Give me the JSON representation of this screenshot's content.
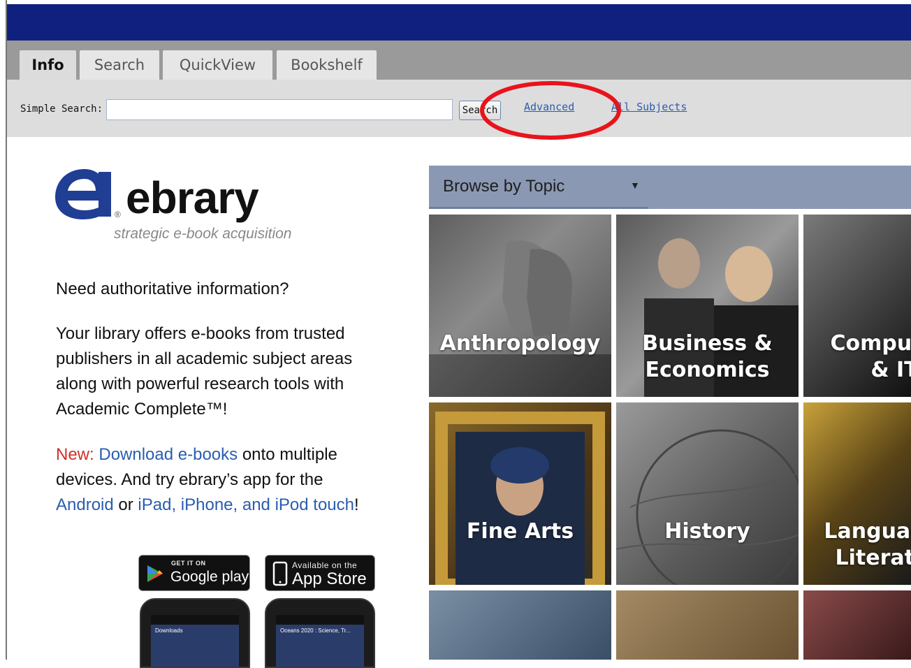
{
  "tabs": [
    {
      "label": "Info",
      "active": true
    },
    {
      "label": "Search",
      "active": false
    },
    {
      "label": "QuickView",
      "active": false
    },
    {
      "label": "Bookshelf",
      "active": false
    }
  ],
  "search": {
    "label": "Simple Search:",
    "value": "",
    "button_label": "Search",
    "advanced_label": "Advanced",
    "subjects_label": "All Subjects"
  },
  "annotation": {
    "color": "#e8141c"
  },
  "logo": {
    "brand": "ebrary",
    "registered": "®",
    "tagline": "strategic e-book acquisition"
  },
  "content": {
    "question": "Need authoritative information?",
    "para1": "Your library offers e-books from trusted publishers in all academic subject areas along with powerful research tools with Academic Complete™!",
    "new_label": "New:",
    "download_link": "Download e-books",
    "download_rest": " onto multiple devices. And try ebrary’s app for the ",
    "android_link": "Android",
    "or_text": " or ",
    "ios_link": "iPad, iPhone, and iPod touch",
    "end": "!"
  },
  "badges": {
    "google_small": "GET IT ON",
    "google_big": "Google play",
    "apple_small": "Available on the",
    "apple_big": "App Store"
  },
  "phones": {
    "android_screen": "Downloads",
    "iphone_screen": "Oceans 2020 : Science, Tr..."
  },
  "browse": {
    "header": "Browse by Topic",
    "tiles": [
      {
        "label": "Anthropology"
      },
      {
        "label": "Business &\nEconomics"
      },
      {
        "label": "Computers\n& IT"
      },
      {
        "label": "Fine Arts"
      },
      {
        "label": "History"
      },
      {
        "label": "Language &\nLiterature"
      },
      {
        "label": ""
      },
      {
        "label": ""
      },
      {
        "label": ""
      }
    ]
  },
  "colors": {
    "navbar": "#10207e",
    "tabbar": "#9a9a9a",
    "link": "#2a5db0",
    "new": "#d0302a",
    "logo_blue": "#1f3e94"
  }
}
